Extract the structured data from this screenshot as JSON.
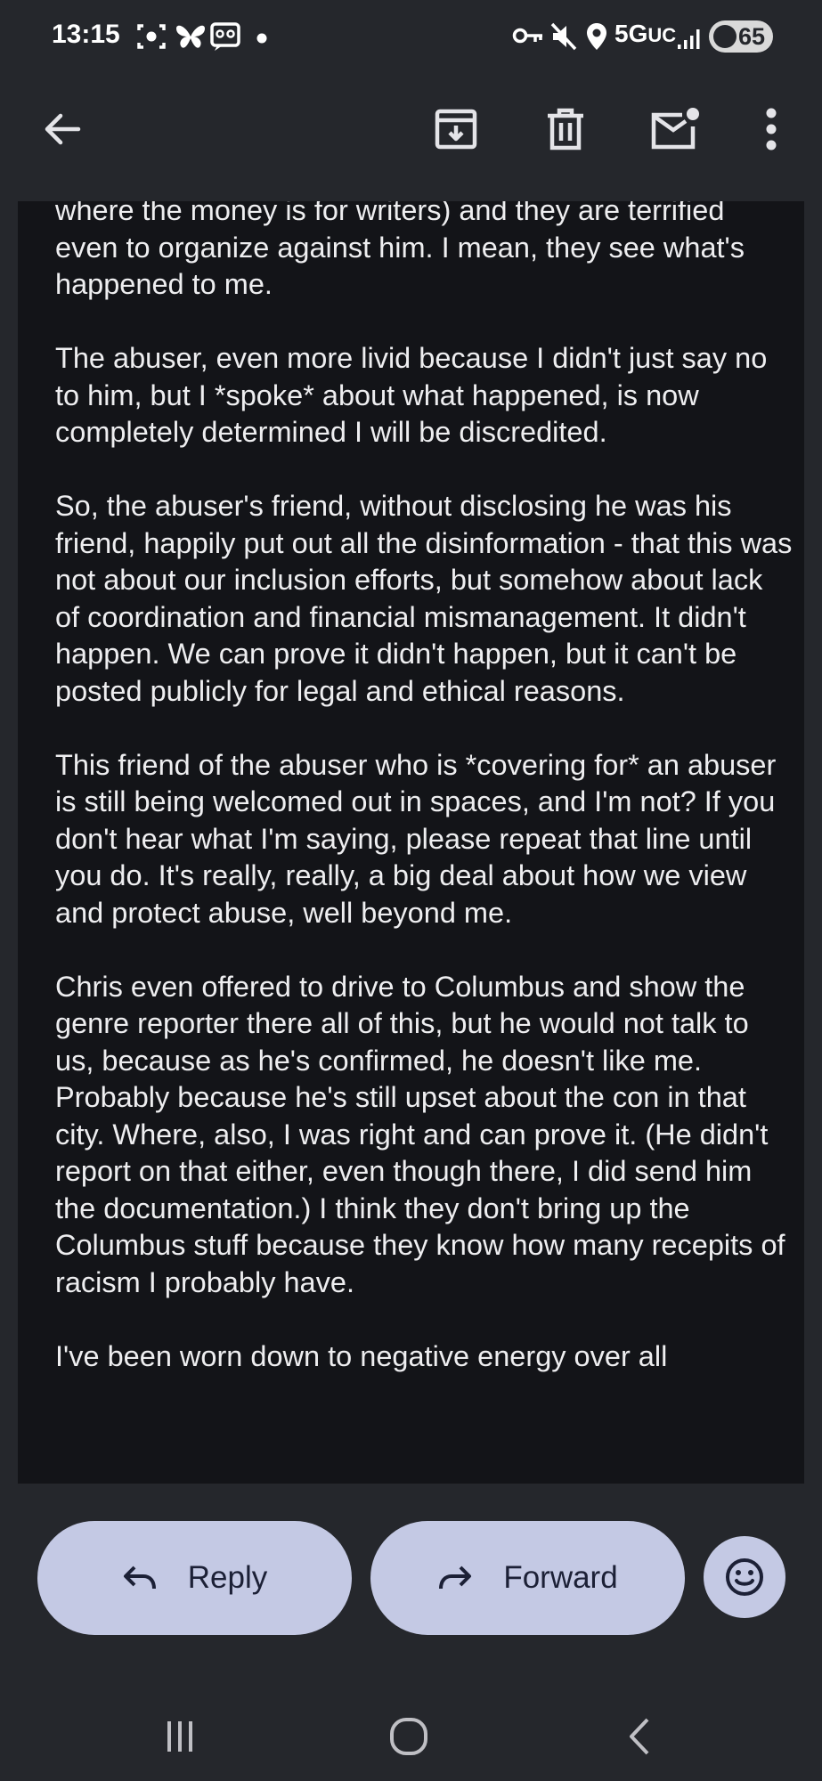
{
  "status_bar": {
    "time": "13:15",
    "network": "5G",
    "network_suffix": "UC",
    "battery": "65",
    "left_icons": [
      "screen-record-icon",
      "butterfly-icon",
      "voicemail-icon",
      "dot-icon"
    ],
    "right_icons": [
      "key-icon",
      "mute-icon",
      "location-icon",
      "signal-icon",
      "battery-icon"
    ]
  },
  "app_bar": {
    "icons": [
      "back-arrow-icon",
      "archive-icon",
      "delete-icon",
      "mark-unread-icon",
      "more-vert-icon"
    ]
  },
  "email": {
    "paragraphs": [
      "where the money is for writers) and they are terrified even to organize against him. I mean, they see what's happened to me.",
      "The abuser, even more livid because I didn't just say no to him, but I *spoke* about what happened, is now completely determined I will be discredited.",
      "So, the abuser's friend, without disclosing he was his friend, happily put out all the disinformation - that this was not about our inclusion efforts, but somehow about lack of coordination and financial mismanagement. It didn't happen. We can prove it didn't happen, but it can't be posted publicly for legal and ethical reasons.",
      "This friend of the abuser who is *covering for* an abuser is still being welcomed out in spaces, and I'm not? If you don't hear what I'm saying, please repeat that line until you do. It's really, really, a big deal about how we view and protect abuse, well beyond me.",
      "Chris even offered to drive to Columbus and show the genre reporter there all of this, but he would not talk to us, because as he's confirmed, he doesn't like me. Probably because he's still upset about the con in that city. Where, also, I was right and can prove it. (He didn't report on that either, even though there, I did send him the documentation.) I think they don't bring up the Columbus stuff because they know how many recepits of racism I probably have.",
      "I've been worn down to negative energy over all"
    ]
  },
  "actions": {
    "reply_label": "Reply",
    "forward_label": "Forward"
  },
  "colors": {
    "background": "#25272c",
    "card": "#131418",
    "button": "#c4c9e4",
    "button_text": "#1c2036"
  }
}
